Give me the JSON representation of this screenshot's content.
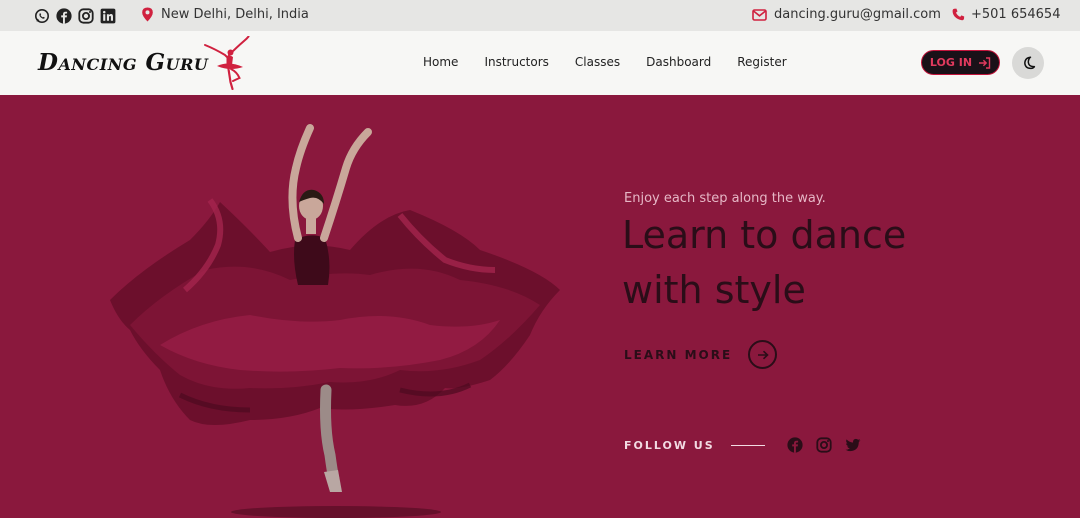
{
  "topbar": {
    "social_icons": [
      "whatsapp-icon",
      "facebook-icon",
      "instagram-icon",
      "linkedin-icon"
    ],
    "location": "New Delhi, Delhi, India",
    "email": "dancing.guru@gmail.com",
    "phone": "+501 654654"
  },
  "header": {
    "logo_text": "Dancing Guru",
    "nav": [
      "Home",
      "Instructors",
      "Classes",
      "Dashboard",
      "Register"
    ],
    "login_label": "LOG IN"
  },
  "hero": {
    "tagline": "Enjoy each step along the way.",
    "headline": "Learn to dance with style",
    "learn_more": "LEARN MORE",
    "follow_us": "FOLLOW US",
    "social_icons": [
      "facebook-icon",
      "instagram-icon",
      "twitter-icon"
    ]
  },
  "colors": {
    "hero_bg": "#8a183d",
    "accent_red": "#d0213f",
    "topbar_bg": "#e6e6e4",
    "header_bg": "#f7f7f5",
    "headline_text": "#2a0d18"
  }
}
